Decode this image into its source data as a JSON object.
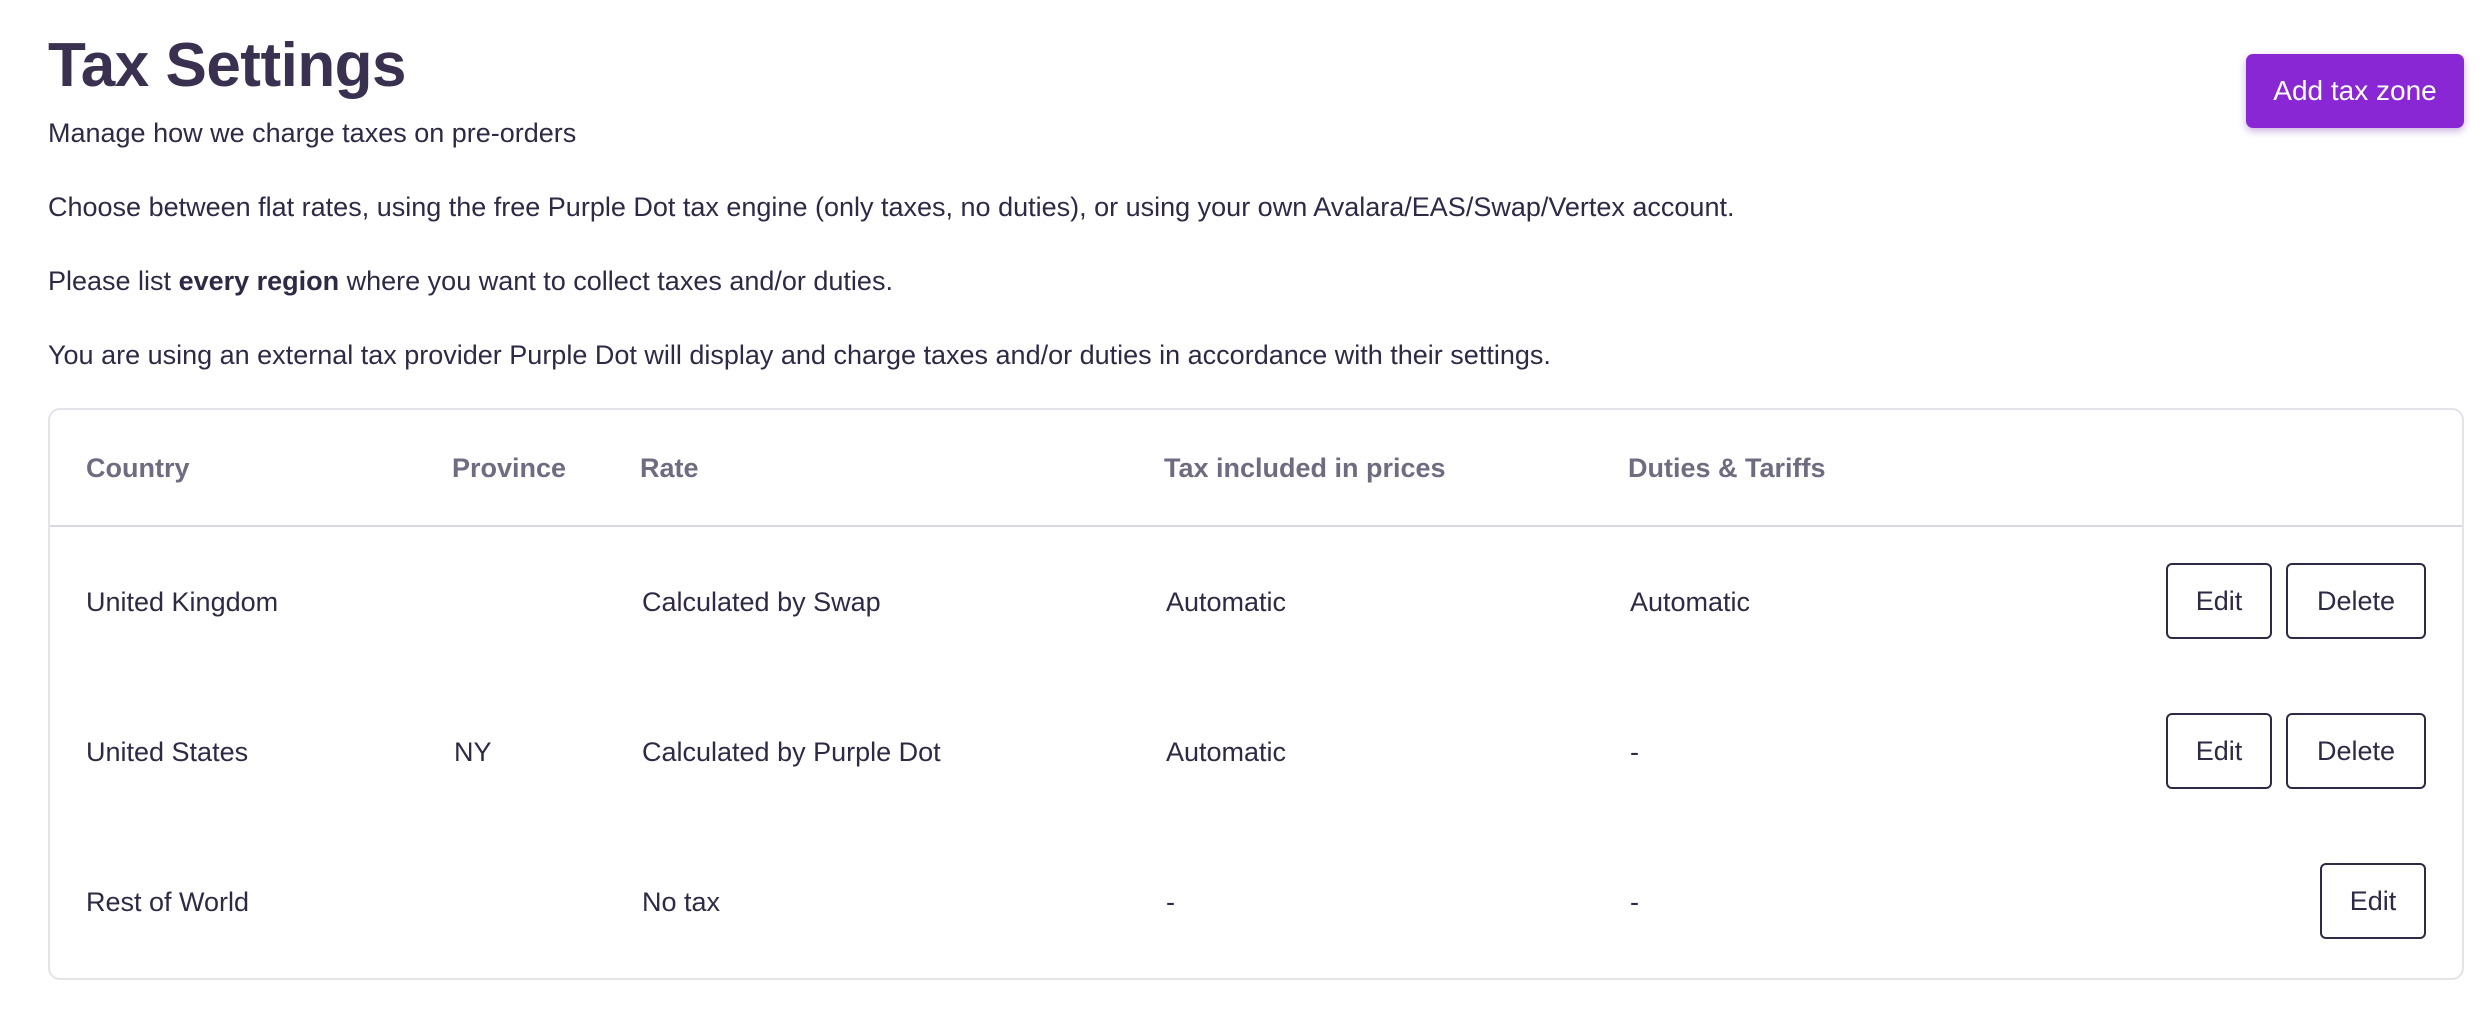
{
  "header": {
    "title": "Tax Settings",
    "subtitle": "Manage how we charge taxes on pre-orders",
    "add_button": "Add tax zone"
  },
  "info": {
    "line1": "Choose between flat rates, using the free Purple Dot tax engine (only taxes, no duties), or using your own Avalara/EAS/Swap/Vertex account.",
    "line2_before": "Please list ",
    "line2_bold": "every region",
    "line2_after": " where you want to collect taxes and/or duties.",
    "line3": "You are using an external tax provider Purple Dot will display and charge taxes and/or duties in accordance with their settings."
  },
  "table": {
    "columns": {
      "country": "Country",
      "province": "Province",
      "rate": "Rate",
      "tax_included": "Tax included in prices",
      "duties": "Duties & Tariffs"
    },
    "rows": [
      {
        "country": "United Kingdom",
        "province": "",
        "rate": "Calculated by Swap",
        "tax_included": "Automatic",
        "duties": "Automatic",
        "edit_label": "Edit",
        "delete_label": "Delete"
      },
      {
        "country": "United States",
        "province": "NY",
        "rate": "Calculated by Purple Dot",
        "tax_included": "Automatic",
        "duties": "-",
        "edit_label": "Edit",
        "delete_label": "Delete"
      },
      {
        "country": "Rest of World",
        "province": "",
        "rate": "No tax",
        "tax_included": "-",
        "duties": "-",
        "edit_label": "Edit"
      }
    ]
  },
  "colors": {
    "accent": "#8a27d4",
    "text": "#2e2a45",
    "header_text": "#6f6b80",
    "border": "#e4e3ea"
  }
}
